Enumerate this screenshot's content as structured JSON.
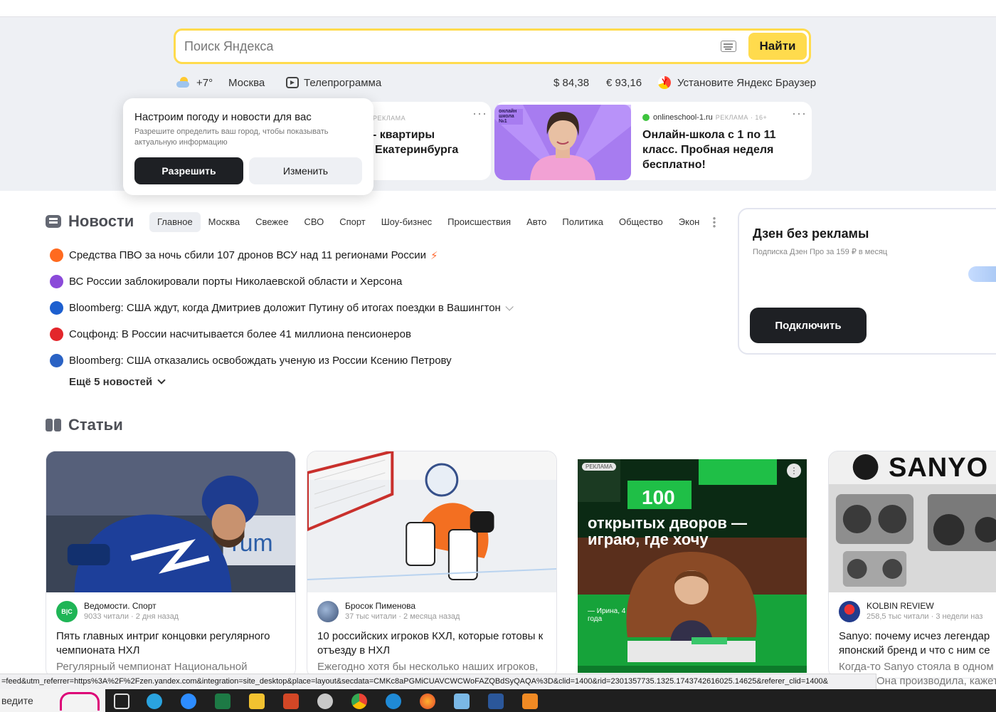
{
  "search": {
    "placeholder": "Поиск Яндекса",
    "button": "Найти"
  },
  "infobar": {
    "temperature": "+7°",
    "city": "Москва",
    "tv": "Телепрограмма",
    "usd": "$ 84,38",
    "eur": "€ 93,16",
    "browser_promo": "Установите Яндекс Браузер"
  },
  "popup": {
    "title": "Настроим погоду и новости для вас",
    "text": "Разрешите определить ваш город, чтобы показывать актуальную информацию",
    "allow": "Разрешить",
    "change": "Изменить"
  },
  "ads": {
    "flat": {
      "label": "РЕКЛАМА",
      "title_line1": "- квартиры",
      "title_line2": "Екатеринбурга"
    },
    "school": {
      "domain": "onlineschool-1.ru",
      "label": "РЕКЛАМА · 16+",
      "badge": "онлайн школа №1",
      "title": "Онлайн-школа с 1 по 11 класс. Пробная неделя бесплатно!"
    }
  },
  "news": {
    "title": "Новости",
    "tabs": [
      "Главное",
      "Москва",
      "Свежее",
      "СВО",
      "Спорт",
      "Шоу-бизнес",
      "Происшествия",
      "Авто",
      "Политика",
      "Общество",
      "Экон"
    ],
    "items": [
      {
        "text": "Средства ПВО за ночь сбили 107 дронов ВСУ над 11 регионами России",
        "color": "#ff6a1f"
      },
      {
        "text": "ВС России заблокировали порты Николаевской области и Херсона",
        "color": "#8b4ad9"
      },
      {
        "text": "Bloomberg: США ждут, когда Дмитриев доложит Путину об итогах поездки в Вашингтон",
        "color": "#1d5fcf"
      },
      {
        "text": "Соцфонд: В России насчитывается более 41 миллиона пенсионеров",
        "color": "#e3262b"
      },
      {
        "text": "Bloomberg: США отказались освобождать ученую из России Ксению Петрову",
        "color": "#2a62c4"
      }
    ],
    "more": "Ещё 5 новостей"
  },
  "dzen": {
    "title": "Дзен без рекламы",
    "subtitle": "Подписка Дзен Про за 159 ₽ в месяц",
    "button": "Подключить"
  },
  "articles": {
    "title": "Статьи",
    "cards": [
      {
        "source": "Ведомости. Спорт",
        "reads": "9033 читали · 2 дня назад",
        "title": "Пять главных интриг концовки регулярного чемпионата НХЛ",
        "snippet": "Регулярный чемпионат Национальной"
      },
      {
        "source": "Бросок Пименова",
        "reads": "37 тыс читали · 2 месяца назад",
        "title": "10 российских игроков КХЛ, которые готовы к отъезду в НХЛ",
        "snippet": "Ежегодно хотя бы несколько наших игроков,"
      },
      {
        "ad_label": "РЕКЛАМА",
        "headline_num": "100",
        "headline": "открытых дворов — играю, где хочу",
        "caption": "— Ирина, 4 года"
      },
      {
        "brand": "SANYO",
        "source": "KOLBIN REVIEW",
        "reads": "258,5 тыс читали · 3 недели наз",
        "title": "Sanyo: почему исчез легендар японский бренд и что с ним се",
        "snippet": "Когда-то Sanyo стояла в одном"
      }
    ]
  },
  "statusbar": {
    "url": "=feed&utm_referrer=https%3A%2F%2Fzen.yandex.com&integration=site_desktop&place=layout&secdata=CMKc8aPGMiCUAVCWCWoFAZQBdSyQAQA%3D&clid=1400&rid=2301357735.1325.1743742616025.14625&referer_clid=1400&",
    "overflow_text": "Она производила, кажет"
  },
  "taskbar": {
    "search_text": "ведите"
  }
}
